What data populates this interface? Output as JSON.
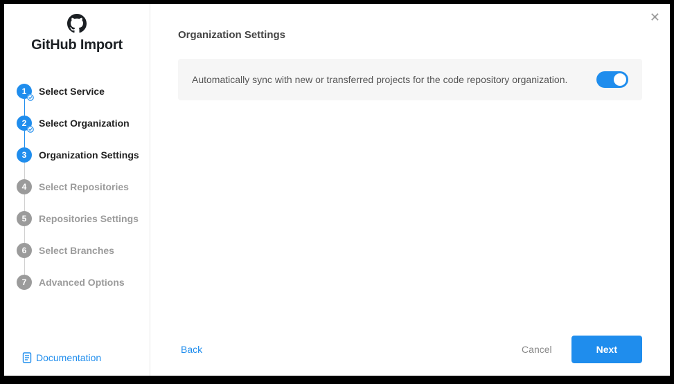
{
  "brand": {
    "title": "GitHub Import"
  },
  "steps": [
    {
      "label": "Select Service",
      "status": "done"
    },
    {
      "label": "Select Organization",
      "status": "done"
    },
    {
      "label": "Organization Settings",
      "status": "active"
    },
    {
      "label": "Select Repositories",
      "status": "pending"
    },
    {
      "label": "Repositories Settings",
      "status": "pending"
    },
    {
      "label": "Select Branches",
      "status": "pending"
    },
    {
      "label": "Advanced Options",
      "status": "pending"
    }
  ],
  "doc_link": "Documentation",
  "main": {
    "title": "Organization Settings",
    "setting_text": "Automatically sync with new or transferred projects for the code repository organization.",
    "toggle_on": true
  },
  "footer": {
    "back": "Back",
    "cancel": "Cancel",
    "next": "Next"
  }
}
